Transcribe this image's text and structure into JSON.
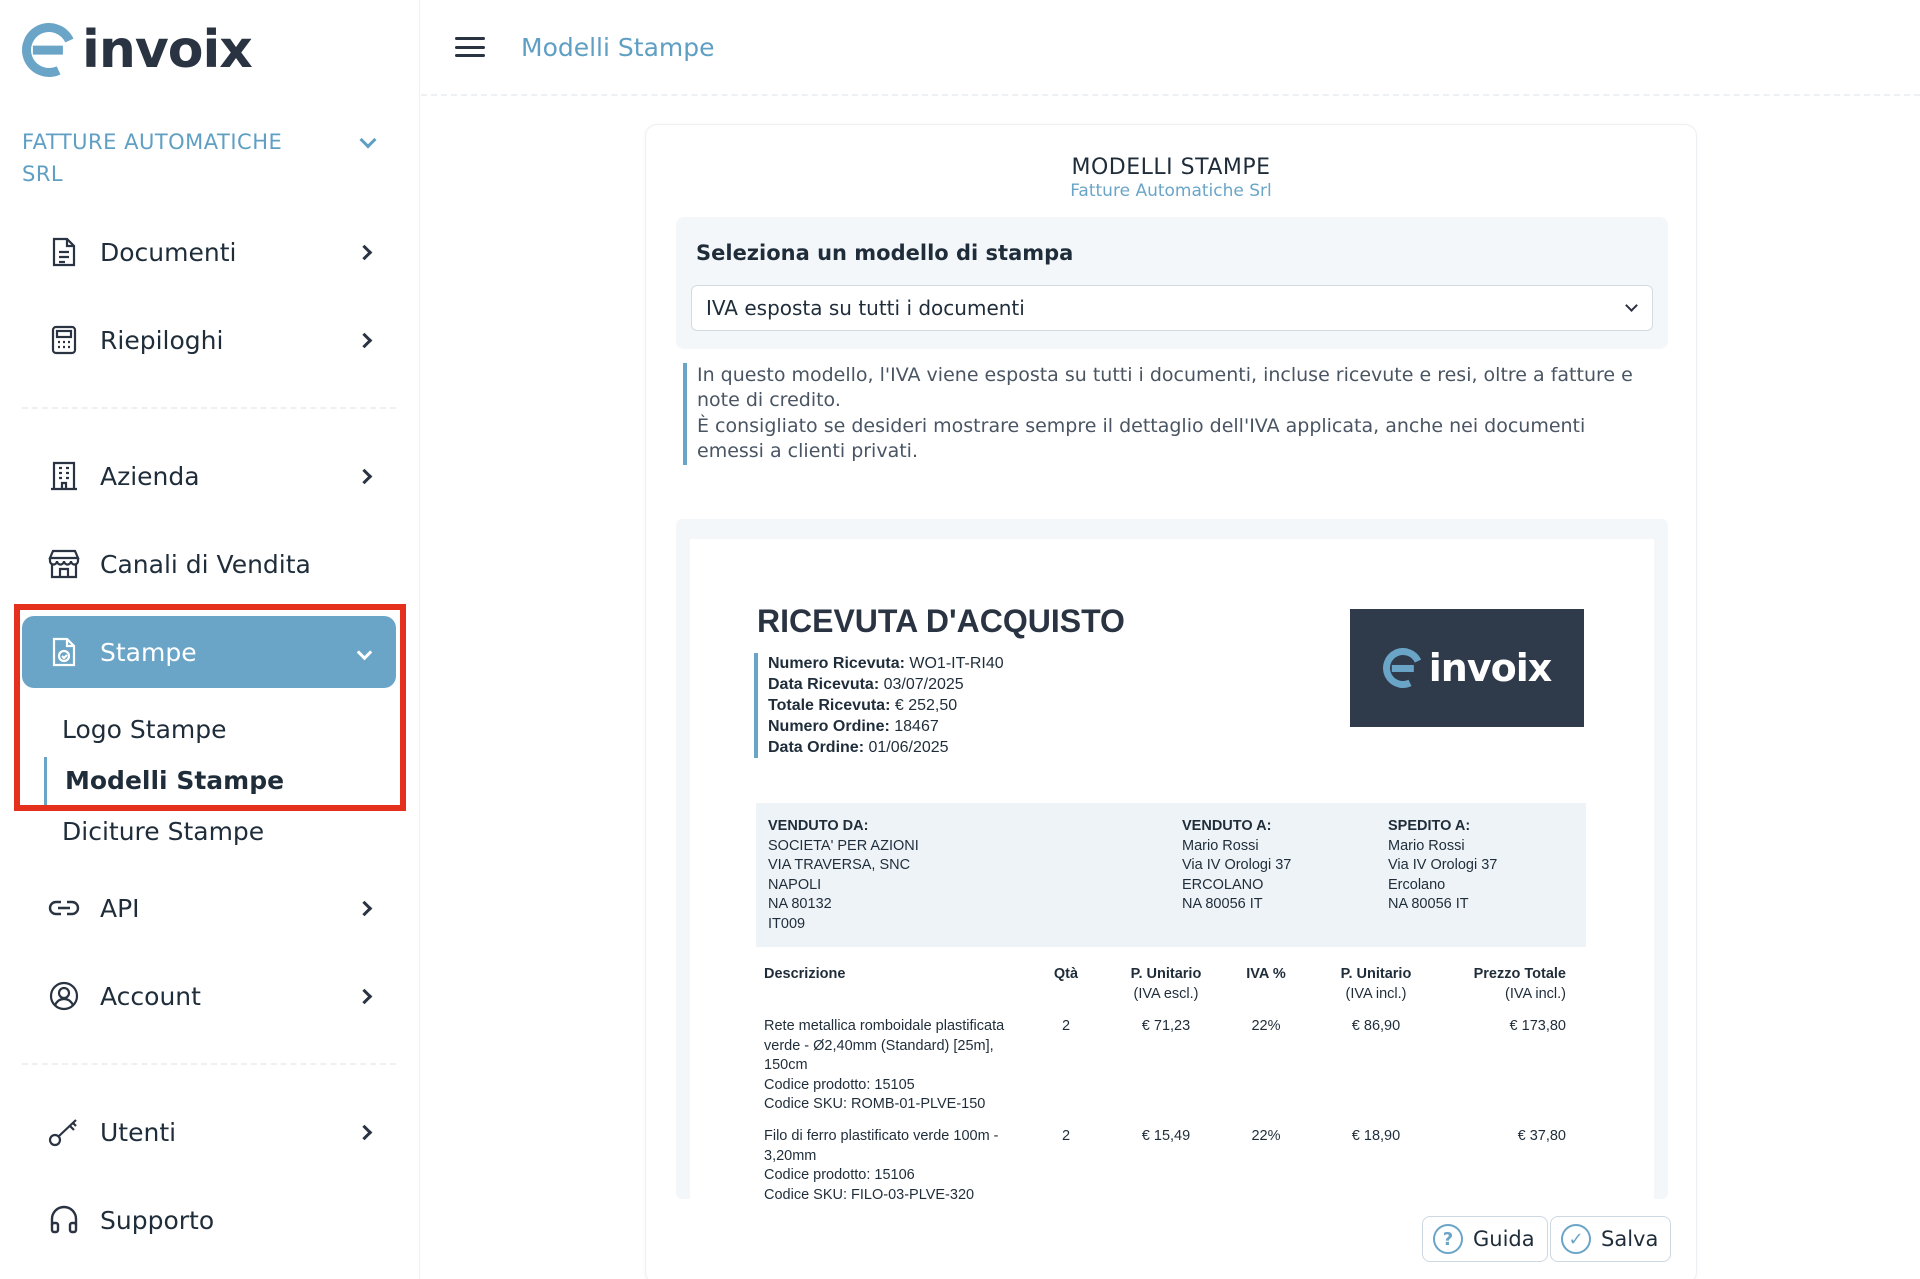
{
  "brand": {
    "logo_text": "invoix",
    "accent": "#6aa5c8",
    "dark": "#2a3342",
    "highlight": "#e5301d"
  },
  "sidebar": {
    "company": "FATTURE AUTOMATICHE SRL",
    "items": [
      {
        "label": "Documenti",
        "icon": "document-icon"
      },
      {
        "label": "Riepiloghi",
        "icon": "calculator-icon"
      },
      {
        "label": "Azienda",
        "icon": "building-icon"
      },
      {
        "label": "Canali di Vendita",
        "icon": "store-icon"
      },
      {
        "label": "Stampe",
        "icon": "print-doc-icon"
      },
      {
        "label": "API",
        "icon": "link-icon"
      },
      {
        "label": "Account",
        "icon": "user-circle-icon"
      },
      {
        "label": "Utenti",
        "icon": "key-icon"
      },
      {
        "label": "Supporto",
        "icon": "headset-icon"
      }
    ],
    "stampe_sub": [
      "Logo Stampe",
      "Modelli Stampe",
      "Diciture Stampe"
    ]
  },
  "header": {
    "title": "Modelli Stampe"
  },
  "card": {
    "title": "MODELLI STAMPE",
    "subtitle": "Fatture Automatiche Srl",
    "select_label": "Seleziona un modello di stampa",
    "select_value": "IVA esposta su tutti i documenti",
    "info_1": "In questo modello, l'IVA viene esposta su tutti i documenti, incluse ricevute e resi, oltre a fatture e note di credito.",
    "info_2": "È consigliato se desideri mostrare sempre il dettaglio dell'IVA applicata, anche nei documenti emessi a clienti privati."
  },
  "receipt": {
    "title": "RICEVUTA D'ACQUISTO",
    "meta": [
      {
        "k": "Numero Ricevuta:",
        "v": "WO1-IT-RI40"
      },
      {
        "k": "Data Ricevuta:",
        "v": "03/07/2025"
      },
      {
        "k": "Totale Ricevuta:",
        "v": "€ 252,50"
      },
      {
        "k": "Numero Ordine:",
        "v": "18467"
      },
      {
        "k": "Data Ordine:",
        "v": "01/06/2025"
      }
    ],
    "sold_by": {
      "h": "VENDUTO DA:",
      "lines": [
        "SOCIETA' PER AZIONI",
        "VIA TRAVERSA, SNC",
        "NAPOLI",
        "NA 80132",
        "IT009"
      ]
    },
    "sold_to": {
      "h": "VENDUTO A:",
      "lines": [
        "Mario Rossi",
        "Via IV Orologi 37",
        "ERCOLANO",
        "NA 80056 IT"
      ]
    },
    "shipped_to": {
      "h": "SPEDITO A:",
      "lines": [
        "Mario Rossi",
        "Via IV Orologi 37",
        "Ercolano",
        "NA 80056 IT"
      ]
    },
    "cols": {
      "desc": "Descrizione",
      "qty": "Qtà",
      "pu1": "P. Unitario",
      "pu1_sub": "(IVA escl.)",
      "iva": "IVA %",
      "pu2": "P. Unitario",
      "pu2_sub": "(IVA incl.)",
      "tot": "Prezzo Totale",
      "tot_sub": "(IVA incl.)"
    },
    "rows": [
      {
        "desc": [
          "Rete metallica romboidale plastificata",
          "verde - Ø2,40mm (Standard) [25m],",
          "150cm",
          "Codice prodotto: 15105",
          "Codice SKU: ROMB-01-PLVE-150"
        ],
        "qty": "2",
        "pu1": "€ 71,23",
        "iva": "22%",
        "pu2": "€ 86,90",
        "tot": "€ 173,80"
      },
      {
        "desc": [
          "Filo di ferro plastificato verde 100m -",
          "3,20mm",
          "Codice prodotto: 15106",
          "Codice SKU: FILO-03-PLVE-320"
        ],
        "qty": "2",
        "pu1": "€ 15,49",
        "iva": "22%",
        "pu2": "€ 18,90",
        "tot": "€ 37,80"
      }
    ]
  },
  "buttons": {
    "guide": "Guida",
    "save": "Salva"
  }
}
